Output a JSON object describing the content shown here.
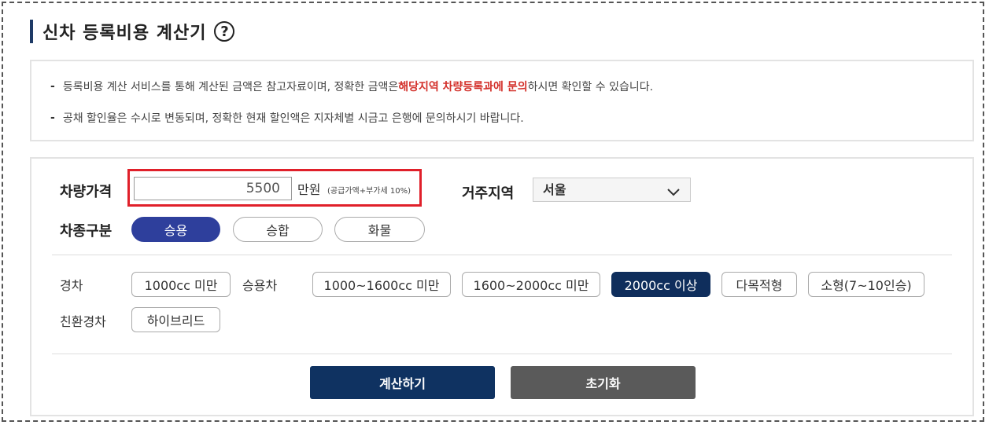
{
  "header": {
    "title": "신차 등록비용 계산기",
    "help_icon": "?"
  },
  "notice": {
    "line1_pre": "등록비용 계산 서비스를 통해 계산된 금액은 참고자료이며, 정확한 금액은 ",
    "line1_em": "해당지역 차량등록과에 문의",
    "line1_post": "하시면 확인할 수 있습니다.",
    "line2": "공채 할인율은 수시로 변동되며, 정확한 현재 할인액은 지자체별 시금고 은행에 문의하시기 바랍니다."
  },
  "form": {
    "price_label": "차량가격",
    "price_value": "5500",
    "price_unit": "만원",
    "price_note": "(공급가액+부가세 10%)",
    "region_label": "거주지역",
    "region_value": "서울",
    "type_label": "차종구분",
    "types": [
      "승용",
      "승합",
      "화물"
    ],
    "selected_type": "승용",
    "light_label": "경차",
    "light_option": "1000cc 미만",
    "passenger_label": "승용차",
    "passenger_options": [
      "1000~1600cc 미만",
      "1600~2000cc 미만",
      "2000cc 이상",
      "다목적형",
      "소형(7~10인승)"
    ],
    "selected_option": "2000cc 이상",
    "eco_label": "친환경차",
    "eco_option": "하이브리드"
  },
  "buttons": {
    "calculate": "계산하기",
    "reset": "초기화"
  },
  "colors": {
    "accent": "#0f3261",
    "type_active": "#2e3f9c",
    "highlight_border": "#e0202a",
    "notice_em": "#d3302a"
  }
}
